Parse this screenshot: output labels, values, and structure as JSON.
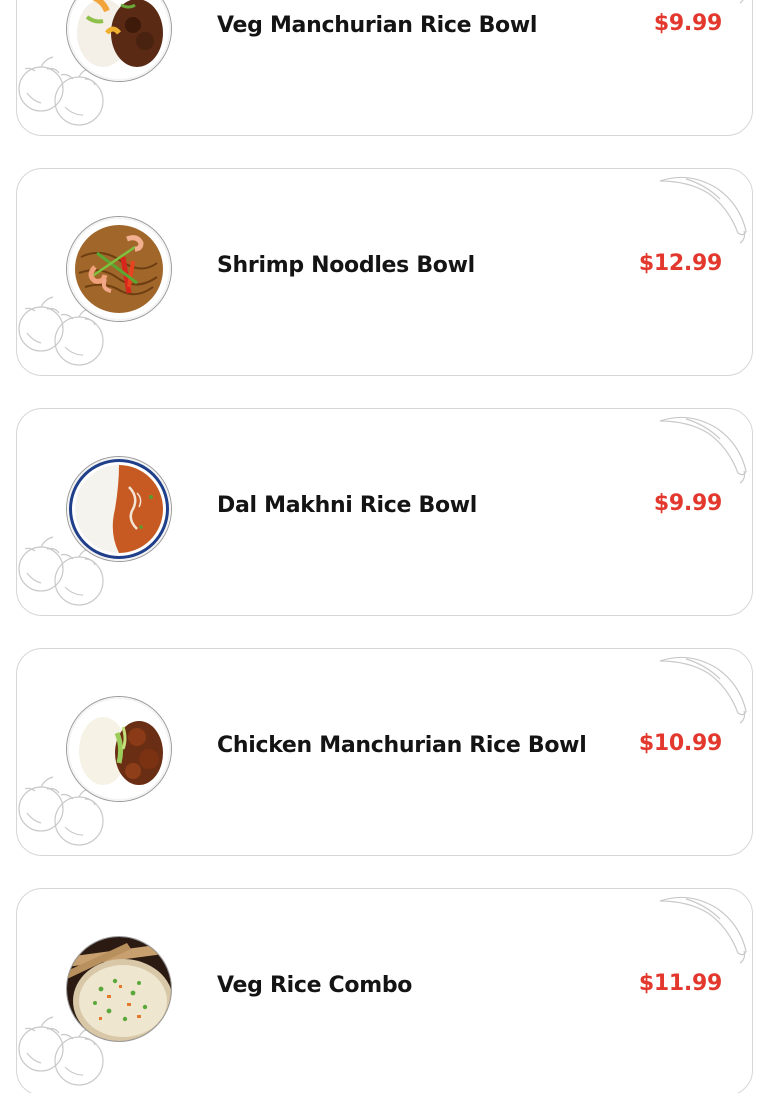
{
  "menu": {
    "items": [
      {
        "name": "Veg Manchurian Rice Bowl",
        "price": "$9.99",
        "image_icon": "veg-manchurian-rice-bowl-photo"
      },
      {
        "name": "Shrimp Noodles Bowl",
        "price": "$12.99",
        "image_icon": "shrimp-noodles-bowl-photo"
      },
      {
        "name": "Dal Makhni Rice Bowl",
        "price": "$9.99",
        "image_icon": "dal-makhni-rice-bowl-photo"
      },
      {
        "name": "Chicken Manchurian Rice Bowl",
        "price": "$10.99",
        "image_icon": "chicken-manchurian-rice-bowl-photo"
      },
      {
        "name": "Veg Rice Combo",
        "price": "$11.99",
        "image_icon": "veg-rice-combo-photo"
      }
    ],
    "colors": {
      "price": "#e3382d",
      "name": "#141414",
      "card_border": "#d6d6d6",
      "decor_line": "#c9c9c9"
    }
  }
}
